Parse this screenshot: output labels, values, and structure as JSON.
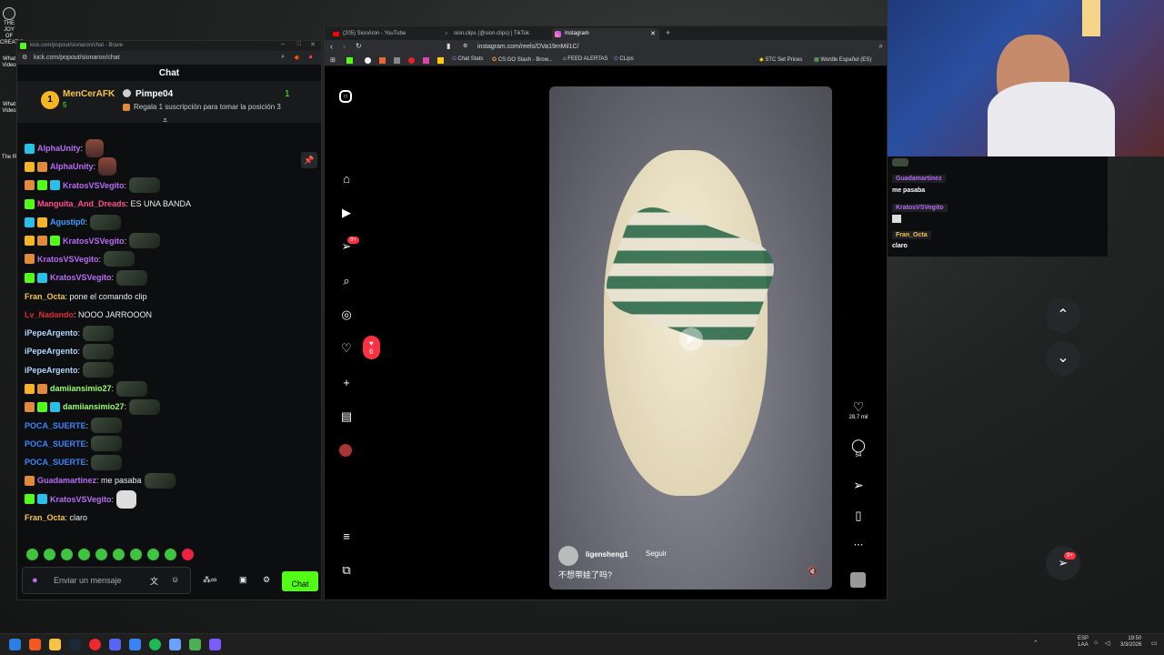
{
  "desktop": {
    "icon1_label": "THE JOY OF CREATIO...",
    "icon2_label": "What Video",
    "icon3_label": "What Video",
    "icon4_label": "The R"
  },
  "chat_window": {
    "title": "kick.com/popout/sionaron/chat - Brave",
    "url": "kick.com/popout/sionaron/chat",
    "header": "Chat",
    "pinned": {
      "rank": "1",
      "user1": "MenCerAFK",
      "user1_count": "5",
      "user2": "Pimpe04",
      "user2_count": "1",
      "promo": "Regala 1 suscripción para tomar la posición 3"
    },
    "messages": [
      {
        "user": "AlphaUnity",
        "text": ":",
        "color": "#b96df6",
        "emote": "t"
      },
      {
        "user": "AlphaUnity",
        "text": ":",
        "color": "#b96df6",
        "emote": "t"
      },
      {
        "user": "KratosVSVegito",
        "text": ":",
        "color": "#b96df6",
        "emote": "g"
      },
      {
        "user": "Manguita_And_Dreads",
        "text": ": ES UNA BANDA",
        "color": "#ff4d8d",
        "emote": ""
      },
      {
        "user": "Agustip0",
        "text": ":",
        "color": "#3aa0ff",
        "emote": "g"
      },
      {
        "user": "KratosVSVegito",
        "text": ":",
        "color": "#b96df6",
        "emote": "g"
      },
      {
        "user": "KratosVSVegito",
        "text": ":",
        "color": "#b96df6",
        "emote": "g"
      },
      {
        "user": "KratosVSVegito",
        "text": ":",
        "color": "#b96df6",
        "emote": "g"
      },
      {
        "user": "Fran_Octa",
        "text": ": pone el comando clip",
        "color": "#f5c44e",
        "emote": ""
      },
      {
        "user": "Lv_Nadando",
        "text": ": NOOO JARROOON",
        "color": "#e0293b",
        "emote": ""
      },
      {
        "user": "iPepeArgento",
        "text": ":",
        "color": "#b3d7ff",
        "emote": "g"
      },
      {
        "user": "iPepeArgento",
        "text": ":",
        "color": "#b3d7ff",
        "emote": "g"
      },
      {
        "user": "iPepeArgento",
        "text": ":",
        "color": "#b3d7ff",
        "emote": "g"
      },
      {
        "user": "damiiansimio27",
        "text": ":",
        "color": "#9cff6a",
        "emote": "g"
      },
      {
        "user": "damiiansimio27",
        "text": ":",
        "color": "#9cff6a",
        "emote": "g"
      },
      {
        "user": "POCA_SUERTE",
        "text": ":",
        "color": "#3a86ff",
        "emote": "g"
      },
      {
        "user": "POCA_SUERTE",
        "text": ":",
        "color": "#3a86ff",
        "emote": "g"
      },
      {
        "user": "POCA_SUERTE",
        "text": ":",
        "color": "#3a86ff",
        "emote": "g"
      },
      {
        "user": "Guadamartinez",
        "text": ": me pasaba",
        "color": "#b96df6",
        "emote": "g"
      },
      {
        "user": "KratosVSVegito",
        "text": ":",
        "color": "#b96df6",
        "emote": "s"
      },
      {
        "user": "Fran_Octa",
        "text": ": claro",
        "color": "#f5c44e",
        "emote": ""
      }
    ],
    "input_placeholder": "Enviar un mensaje",
    "send_label": "Chat"
  },
  "browser": {
    "tabs": [
      "(205) SionAron - YouTube",
      "sion.clips (@sion.clips) | TikTok",
      "Instagram"
    ],
    "url": "instagram.com/reels/DVa19mMil1C/",
    "bookmarks": [
      "Chat Stats",
      "CS:GO Stash - Brow...",
      "FEED ALERTAS",
      "CLips",
      "STC Set Prices",
      "Wordle Español (ES)"
    ],
    "notif_badge": "9+",
    "likes_badge": "6",
    "reel": {
      "likes": "28,7 mil",
      "comments": "54",
      "author": "ligensheng1",
      "follow": "Seguir",
      "caption": "不想带娃了吗?"
    },
    "bottom_badge": "9+"
  },
  "overlay_chat": [
    {
      "user": "Guadamartinez",
      "text": "me pasaba"
    },
    {
      "user": "KratosVSVegito",
      "text": ""
    },
    {
      "user": "Fran_Octa",
      "text": "claro"
    }
  ],
  "taskbar": {
    "lang": "ESP",
    "lang2": "LAA",
    "time": "19:50",
    "date": "3/3/2026"
  }
}
